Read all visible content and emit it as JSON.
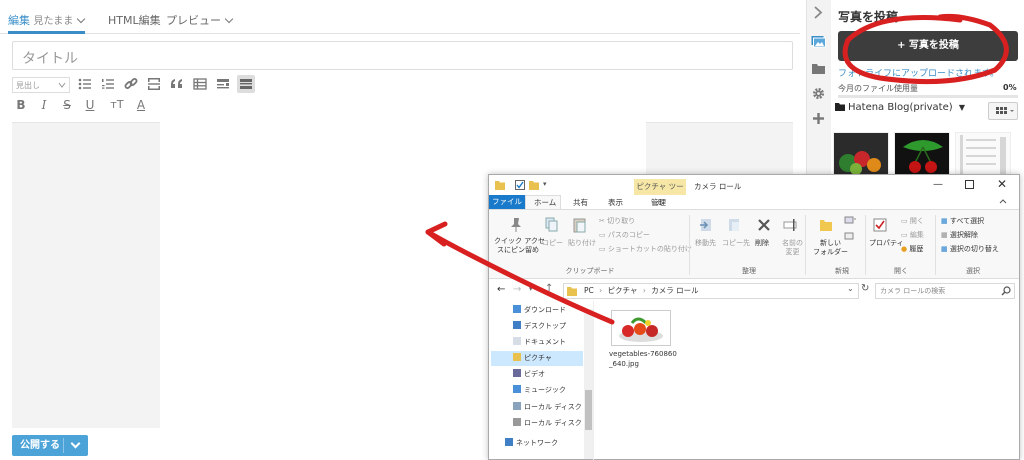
{
  "editor": {
    "tabs": [
      {
        "label": "編集",
        "sub": "見たまま"
      },
      {
        "label": "HTML編集"
      },
      {
        "label": "プレビュー"
      }
    ],
    "title_placeholder": "タイトル",
    "heading_select": "見出し",
    "toolbar_row1": [
      "bullet-list-icon",
      "numbered-list-icon",
      "link-icon",
      "more-icon",
      "quote-icon",
      "table-icon",
      "footnote-icon",
      "toggle-icon"
    ],
    "toolbar_row2": [
      "B",
      "I",
      "S",
      "U",
      "тT",
      "A"
    ],
    "publish_label": "公開する"
  },
  "sidebar_icons": [
    "collapse-arrow-icon",
    "photo-icon",
    "folder-icon",
    "gear-icon",
    "plus-icon"
  ],
  "photo_panel": {
    "title": "写真を投稿",
    "post_button": "+ 写真を投稿",
    "note": "フォトライフにアップロードされます。",
    "usage_label": "今月のファイル使用量",
    "usage_value": "0%",
    "usage_fraction": 0.0,
    "folder": "Hatena Blog(private)"
  },
  "explorer": {
    "context_tab": "ピクチャ ツール",
    "window_title": "カメラ ロール",
    "tabs": [
      "ファイル",
      "ホーム",
      "共有",
      "表示",
      "管理"
    ],
    "ribbon": {
      "pin": "クイック アクセ\nスにピン留め",
      "copy": "コピー",
      "paste": "貼り付け",
      "cut": "切り取り",
      "copy_path": "パスのコピー",
      "paste_shortcut": "ショートカットの貼り付け",
      "move_to": "移動先",
      "copy_to": "コピー先",
      "delete": "削除",
      "rename": "名前の\n変更",
      "new_folder": "新しい\nフォルダー",
      "properties": "プロパティ",
      "open": "開く",
      "edit": "編集",
      "history": "履歴",
      "select_all": "すべて選択",
      "select_none": "選択解除",
      "invert": "選択の切り替え",
      "groups": [
        "クリップボード",
        "整理",
        "新規",
        "開く",
        "選択"
      ]
    },
    "address": [
      "PC",
      "ピクチャ",
      "カメラ ロール"
    ],
    "search_placeholder": "カメラ ロールの検索",
    "nav_items": [
      "ダウンロード",
      "デスクトップ",
      "ドキュメント",
      "ピクチャ",
      "ビデオ",
      "ミュージック",
      "ローカル ディスク (C",
      "ローカル ディスク (D",
      "ネットワーク"
    ],
    "file": {
      "name": "vegetables-760860_640.jpg"
    }
  },
  "colors": {
    "accent": "#3a8ec7",
    "annotation": "#d92020",
    "explorer_file_tab": "#1979ca"
  }
}
